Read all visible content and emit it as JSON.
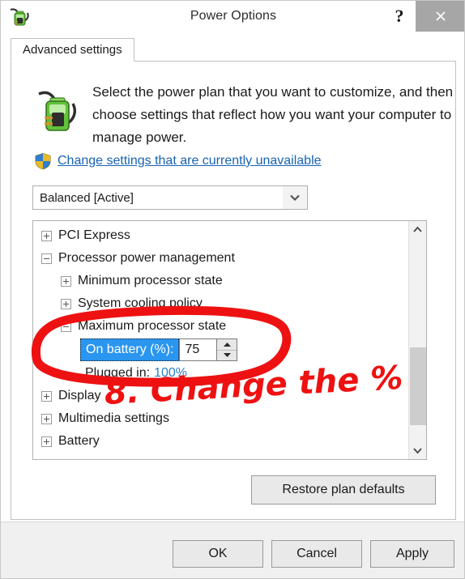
{
  "window": {
    "title": "Power Options",
    "icon": "battery-plug-icon",
    "help_label": "?",
    "close_label": "×"
  },
  "tabs": [
    {
      "label": "Advanced settings",
      "active": true
    }
  ],
  "header": {
    "description": "Select the power plan that you want to customize, and then choose settings that reflect how you want your computer to manage power.",
    "uac_link": "Change settings that are currently unavailable",
    "shield_icon": "uac-shield-icon"
  },
  "plan_combo": {
    "value": "Balanced [Active]",
    "arrow_icon": "chevron-down-icon"
  },
  "tree": {
    "rows": [
      {
        "label": "PCI Express",
        "level": 1,
        "expanded": false
      },
      {
        "label": "Processor power management",
        "level": 1,
        "expanded": true
      },
      {
        "label": "Minimum processor state",
        "level": 2,
        "expanded": false
      },
      {
        "label": "System cooling policy",
        "level": 2,
        "expanded": false
      },
      {
        "label": "Maximum processor state",
        "level": 2,
        "expanded": true
      }
    ],
    "setting": {
      "selected_label": "On battery (%):",
      "value": "75",
      "spin_up_icon": "triangle-up-icon",
      "spin_down_icon": "triangle-down-icon",
      "plugged_label": "Plugged in:",
      "plugged_value": "100%"
    },
    "rows_after": [
      {
        "label": "Display",
        "level": 1,
        "expanded": false
      },
      {
        "label": "Multimedia settings",
        "level": 1,
        "expanded": false
      },
      {
        "label": "Battery",
        "level": 1,
        "expanded": false
      }
    ],
    "scrollbar": {
      "up_icon": "chevron-up-icon",
      "down_icon": "chevron-down-icon"
    }
  },
  "buttons": {
    "restore": "Restore plan defaults",
    "ok": "OK",
    "cancel": "Cancel",
    "apply": "Apply"
  },
  "annotation": {
    "text": "8. Change the %",
    "color": "#ee1111",
    "shape": "red-ellipse-around-on-battery-spinner"
  }
}
